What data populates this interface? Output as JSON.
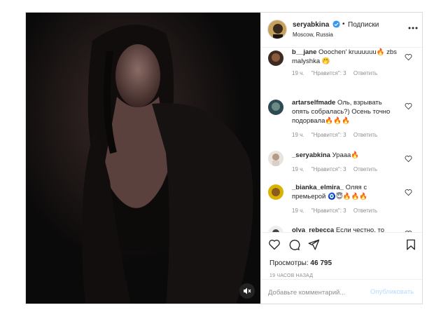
{
  "header": {
    "username": "seryabkina",
    "separator": "•",
    "follow_label": "Подписки",
    "location": "Moscow, Russia",
    "verified_icon": "verified-badge-icon",
    "more_icon": "more-options-icon"
  },
  "comments": [
    {
      "username": "b__jane",
      "text": "Ooochen' kruuuuuu🔥 zbs malyshka 🤭",
      "time": "19 ч.",
      "likes": "\"Нравится\": 3",
      "reply": "Ответить"
    },
    {
      "username": "artarselfmade",
      "text": "Оль, взрывать опять собралась?) Осень точно подорвала🔥🔥🔥",
      "time": "19 ч.",
      "likes": "\"Нравится\": 3",
      "reply": "Ответить"
    },
    {
      "username": "_seryabkina",
      "text": "Урааа🔥",
      "time": "19 ч.",
      "likes": "\"Нравится\": 3",
      "reply": "Ответить"
    },
    {
      "username": "_bianka_elmira_",
      "text": "Оляя с премьерой 🧿😇🔥🔥🔥",
      "time": "19 ч.",
      "likes": "\"Нравится\": 3",
      "reply": "Ответить"
    },
    {
      "username": "olya_rebecca",
      "text": "Если честно, то мне не понравилось... Мне",
      "time": "",
      "likes": "",
      "reply": ""
    }
  ],
  "actions": {
    "like_icon": "heart-icon",
    "comment_icon": "comment-icon",
    "share_icon": "share-icon",
    "save_icon": "bookmark-icon",
    "views_label": "Просмотры:",
    "views_count": "46 795",
    "timestamp": "19 ЧАСОВ НАЗАД"
  },
  "add_comment": {
    "placeholder": "Добавьте комментарий...",
    "publish_label": "Опубликовать"
  },
  "media": {
    "mute_icon": "speaker-muted-icon"
  },
  "colors": {
    "border": "#dbdbdb",
    "meta": "#8e8e8e",
    "publish_disabled": "#b3dbff",
    "verified": "#3897f0"
  }
}
